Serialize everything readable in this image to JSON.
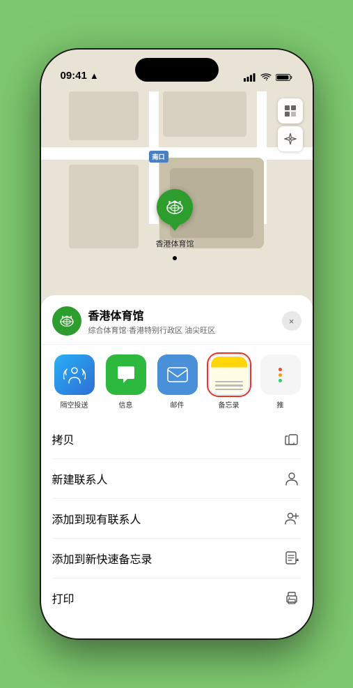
{
  "statusBar": {
    "time": "09:41",
    "locationArrow": "▶"
  },
  "map": {
    "southLabel": "南口",
    "stadiumLabel": "香港体育馆"
  },
  "locationHeader": {
    "name": "香港体育馆",
    "subtitle": "综合体育馆·香港特别行政区 油尖旺区",
    "closeLabel": "×"
  },
  "shareItems": [
    {
      "id": "airdrop",
      "label": "隔空投送"
    },
    {
      "id": "message",
      "label": "信息"
    },
    {
      "id": "mail",
      "label": "邮件"
    },
    {
      "id": "notes",
      "label": "备忘录"
    },
    {
      "id": "more",
      "label": "推"
    }
  ],
  "actionRows": [
    {
      "label": "拷贝",
      "icon": "copy"
    },
    {
      "label": "新建联系人",
      "icon": "person"
    },
    {
      "label": "添加到现有联系人",
      "icon": "person-add"
    },
    {
      "label": "添加到新快速备忘录",
      "icon": "note"
    },
    {
      "label": "打印",
      "icon": "print"
    }
  ]
}
